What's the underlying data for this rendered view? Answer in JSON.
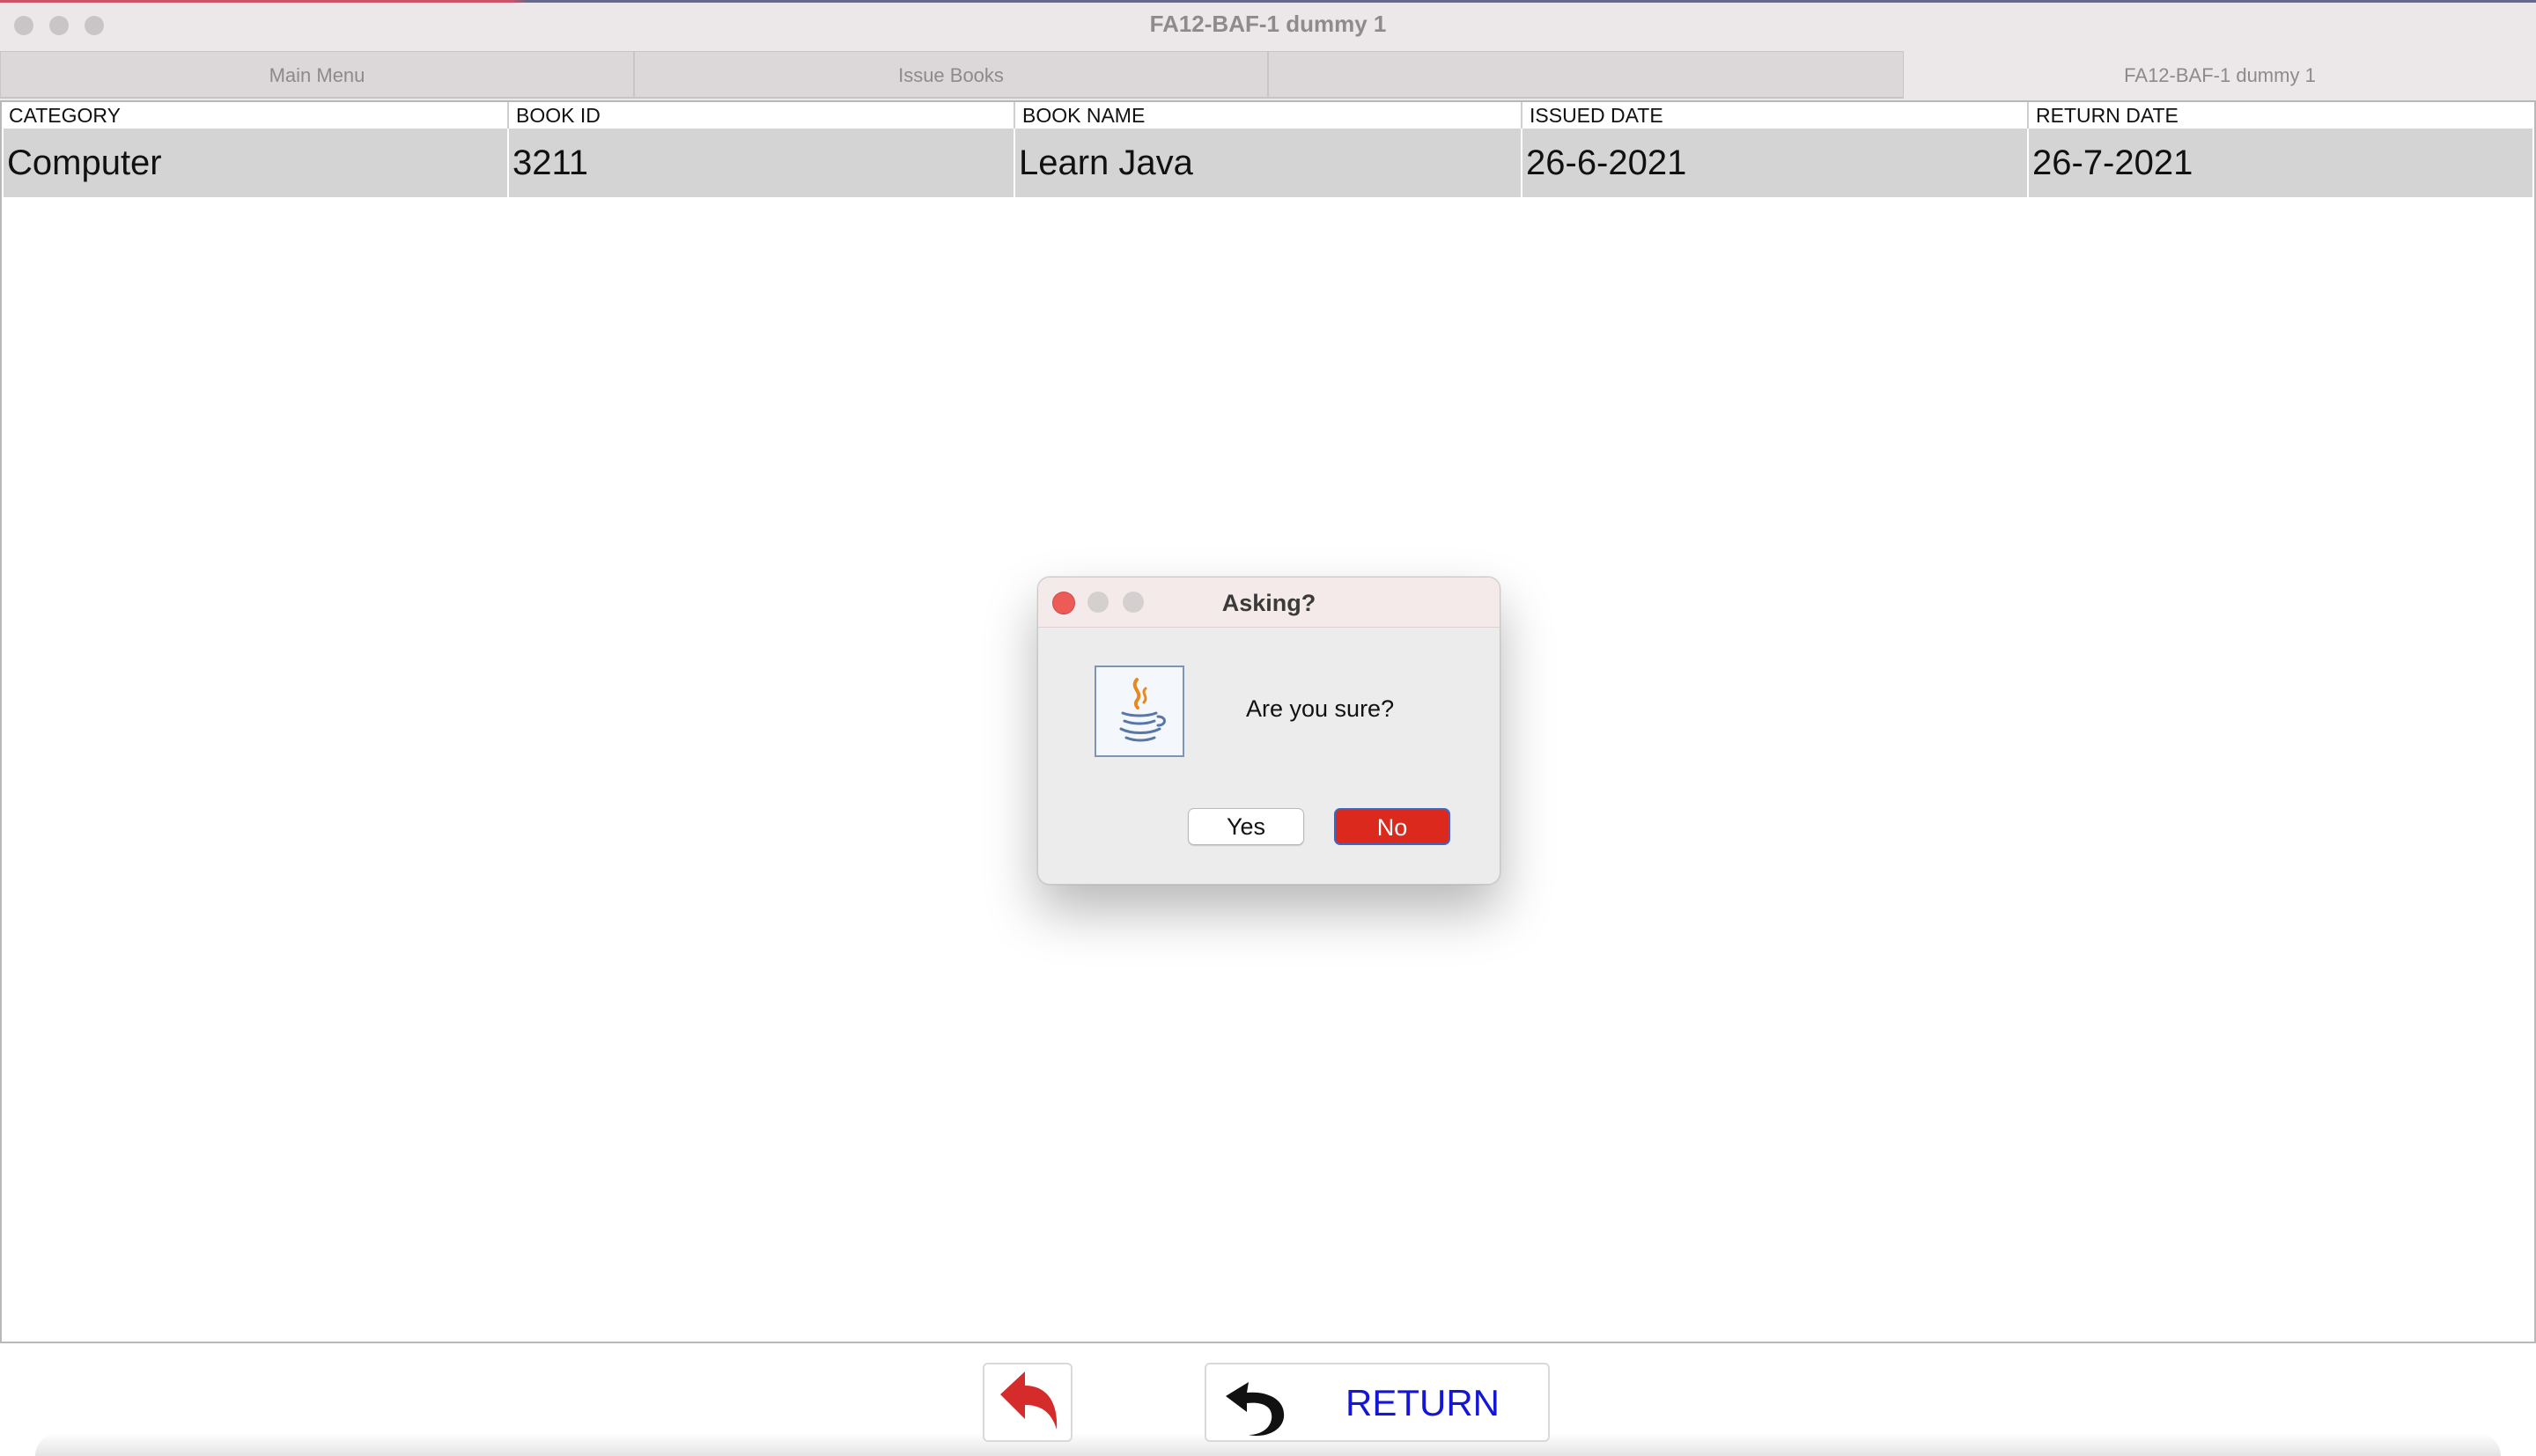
{
  "window": {
    "title": "FA12-BAF-1  dummy 1"
  },
  "tabs": [
    {
      "label": "Main Menu"
    },
    {
      "label": "Issue Books"
    },
    {
      "label": ""
    },
    {
      "label": "FA12-BAF-1  dummy 1"
    }
  ],
  "table": {
    "columns": [
      "CATEGORY",
      "BOOK ID",
      "BOOK NAME",
      "ISSUED DATE",
      "RETURN DATE"
    ],
    "rows": [
      [
        "Computer",
        "3211",
        "Learn Java",
        "26-6-2021",
        "26-7-2021"
      ]
    ]
  },
  "dialog": {
    "title": "Asking?",
    "message": "Are you sure?",
    "icon": "java-icon",
    "yes_label": "Yes",
    "no_label": "No"
  },
  "bottom": {
    "back_icon": "red-back-arrow-icon",
    "return_icon": "undo-arrow-icon",
    "return_label": "RETURN"
  },
  "colors": {
    "accent_no_button": "#db2a1d",
    "return_text": "#1515d8",
    "close_dot": "#ec5b55"
  }
}
